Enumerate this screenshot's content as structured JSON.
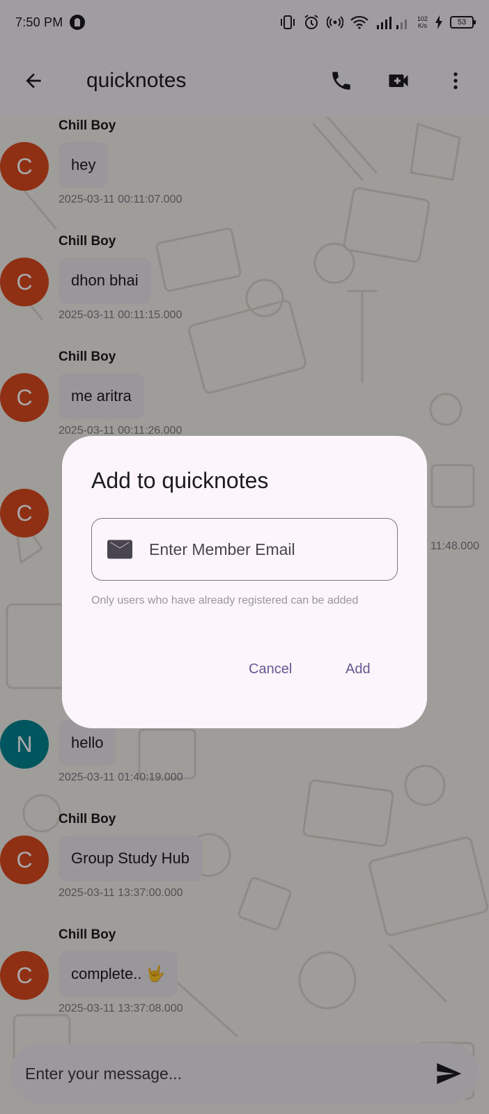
{
  "status_bar": {
    "time": "7:50 PM",
    "net_speed_top": "102",
    "net_speed_bottom": "K/s",
    "battery": "53"
  },
  "app_bar": {
    "title": "quicknotes",
    "back_icon": "arrow-left-icon",
    "call_icon": "phone-icon",
    "video_icon": "video-camera-icon",
    "menu_icon": "more-vert-icon"
  },
  "messages": [
    {
      "avatar": "C",
      "sender": "Chill Boy",
      "text": "hey",
      "time": "2025-03-11 00:11:07.000"
    },
    {
      "avatar": "C",
      "sender": "Chill Boy",
      "text": "dhon bhai",
      "time": "2025-03-11 00:11:15.000"
    },
    {
      "avatar": "C",
      "sender": "Chill Boy",
      "text": "me aritra",
      "time": "2025-03-11 00:11:26.000"
    },
    {
      "avatar": "C",
      "sender": "",
      "text": "",
      "time": "11:48.000"
    },
    {
      "avatar": "N",
      "sender": "",
      "text": "hello",
      "time": "2025-03-11 01:40:19.000"
    },
    {
      "avatar": "C",
      "sender": "Chill Boy",
      "text": "Group Study Hub",
      "time": "2025-03-11 13:37:00.000"
    },
    {
      "avatar": "C",
      "sender": "Chill Boy",
      "text": "complete.. 🤟",
      "time": "2025-03-11 13:37:08.000"
    }
  ],
  "composer": {
    "placeholder": "Enter your message...",
    "send_icon": "send-icon"
  },
  "dialog": {
    "title": "Add to quicknotes",
    "email_placeholder": "Enter Member Email",
    "email_value": "",
    "helper": "Only users who have already registered can be added",
    "cancel_label": "Cancel",
    "add_label": "Add",
    "mail_icon": "mail-icon"
  },
  "colors": {
    "avatar_c": "#d9481f",
    "avatar_n": "#00838f",
    "accent": "#655796"
  }
}
